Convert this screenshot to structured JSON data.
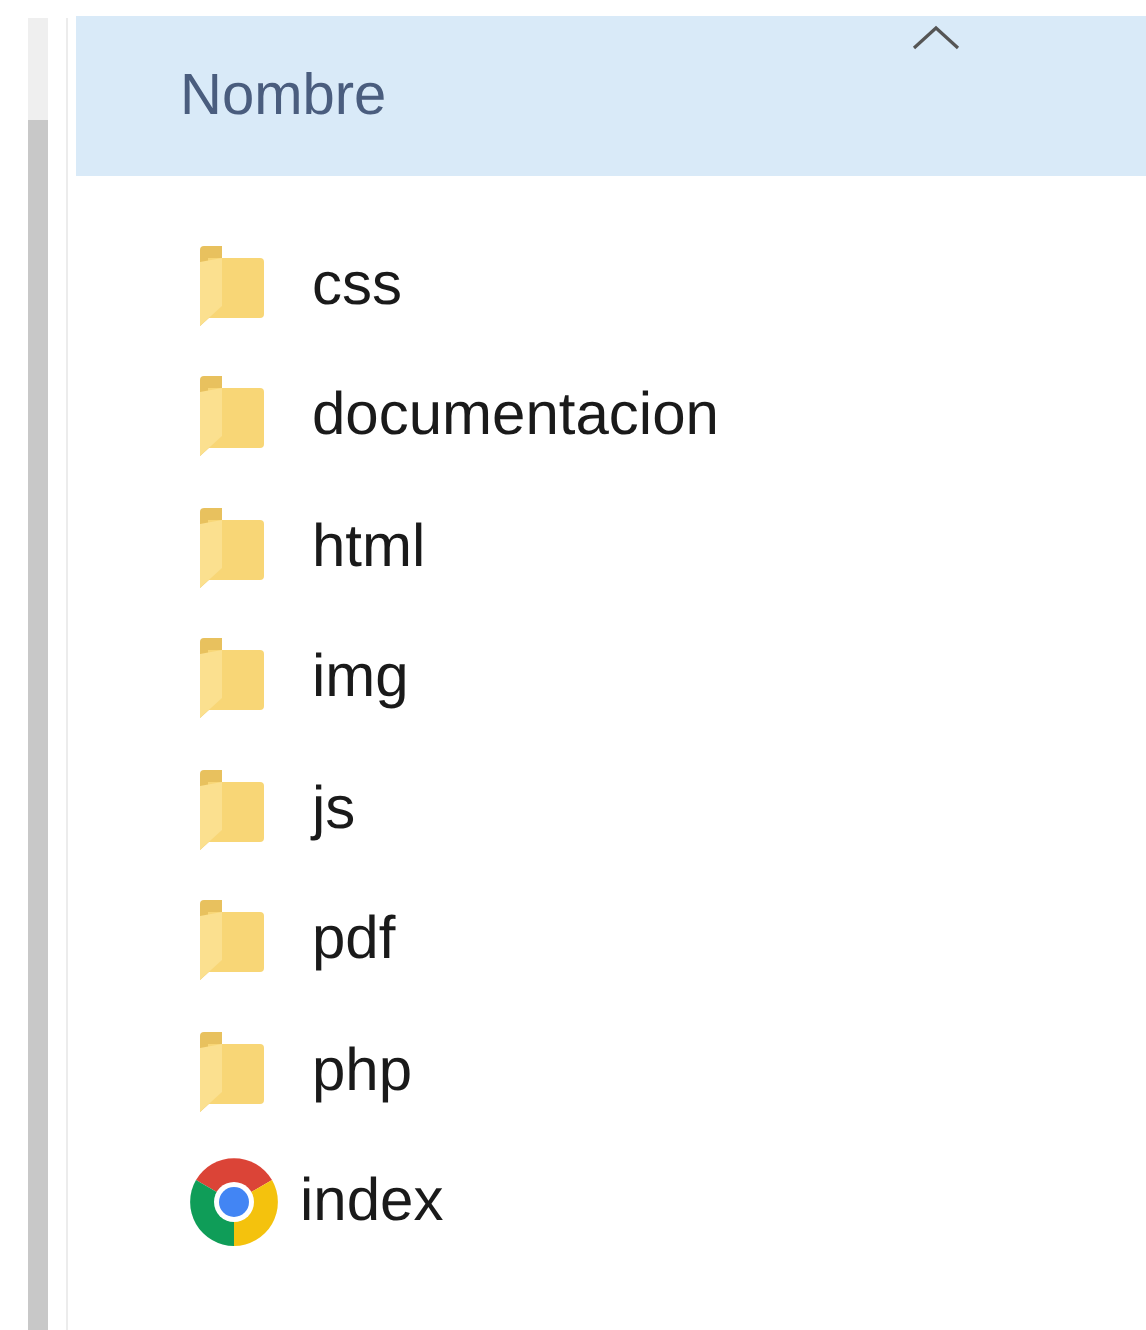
{
  "column_header": {
    "label": "Nombre",
    "sorted_ascending": true
  },
  "files": [
    {
      "name": "css",
      "kind": "folder"
    },
    {
      "name": "documentacion",
      "kind": "folder"
    },
    {
      "name": "html",
      "kind": "folder"
    },
    {
      "name": "img",
      "kind": "folder"
    },
    {
      "name": "js",
      "kind": "folder"
    },
    {
      "name": "pdf",
      "kind": "folder"
    },
    {
      "name": "php",
      "kind": "folder"
    },
    {
      "name": "index",
      "kind": "web-page"
    }
  ]
}
